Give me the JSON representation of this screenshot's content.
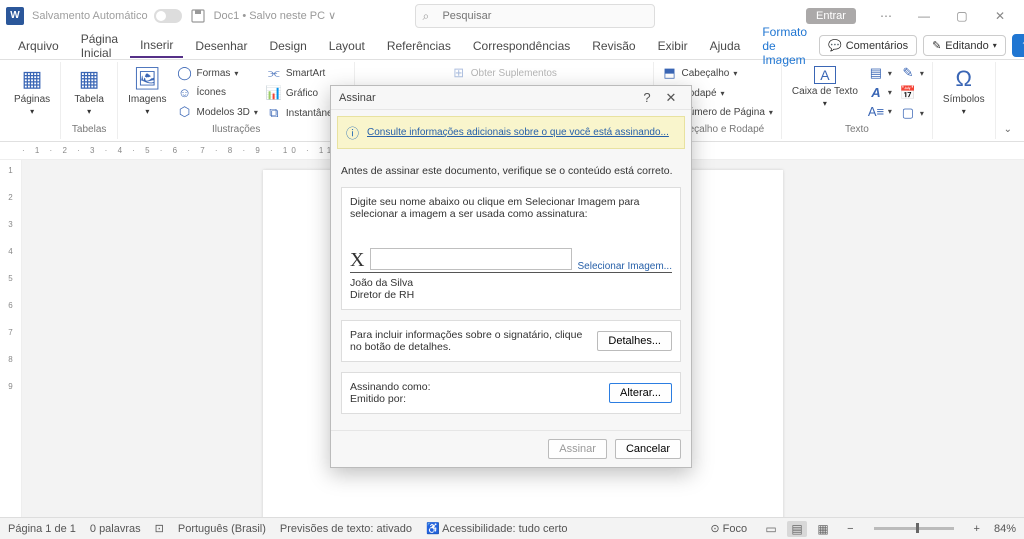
{
  "titlebar": {
    "autosave_label": "Salvamento Automático",
    "doc_name": "Doc1 • Salvo neste PC ∨",
    "search_placeholder": "Pesquisar",
    "entrar": "Entrar"
  },
  "tabs": {
    "arquivo": "Arquivo",
    "pagina_inicial": "Página Inicial",
    "inserir": "Inserir",
    "desenhar": "Desenhar",
    "design": "Design",
    "layout": "Layout",
    "referencias": "Referências",
    "correspondencias": "Correspondências",
    "revisao": "Revisão",
    "exibir": "Exibir",
    "ajuda": "Ajuda",
    "formato_imagem": "Formato de Imagem",
    "comentarios": "Comentários",
    "editando": "Editando"
  },
  "ribbon": {
    "paginas": "Páginas",
    "tabela": "Tabela",
    "tabelas_group": "Tabelas",
    "imagens": "Imagens",
    "formas": "Formas",
    "icones": "Ícones",
    "modelos3d": "Modelos 3D",
    "smartart": "SmartArt",
    "grafico": "Gráfico",
    "instantaneo": "Instantâneo",
    "ilustracoes_group": "Ilustrações",
    "obter_suplementos": "Obter Suplementos",
    "cabecalho": "Cabeçalho",
    "rodape": "Rodapé",
    "numero_pagina": "Número de Página",
    "cab_rodape_group": "Cabeçalho e Rodapé",
    "caixa_texto": "Caixa de Texto",
    "texto_group": "Texto",
    "simbolos": "Símbolos"
  },
  "modal": {
    "title": "Assinar",
    "info_link": "Consulte informações adicionais sobre o que você está assinando...",
    "verify": "Antes de assinar este documento, verifique se o conteúdo está correto.",
    "instruction": "Digite seu nome abaixo ou clique em Selecionar Imagem para selecionar a imagem a ser usada como assinatura:",
    "x": "X",
    "select_image": "Selecionar Imagem...",
    "signer_name": "João da Silva",
    "signer_title": "Diretor de RH",
    "details_text": "Para incluir informações sobre o signatário, clique no botão de detalhes.",
    "details_btn": "Detalhes...",
    "signing_as": "Assinando como:",
    "issued_by": "Emitido por:",
    "change_btn": "Alterar...",
    "sign_btn": "Assinar",
    "cancel_btn": "Cancelar"
  },
  "statusbar": {
    "page": "Página 1 de 1",
    "words": "0 palavras",
    "lang": "Português (Brasil)",
    "predictions": "Previsões de texto: ativado",
    "accessibility": "Acessibilidade: tudo certo",
    "focus": "Foco",
    "zoom": "84%"
  }
}
